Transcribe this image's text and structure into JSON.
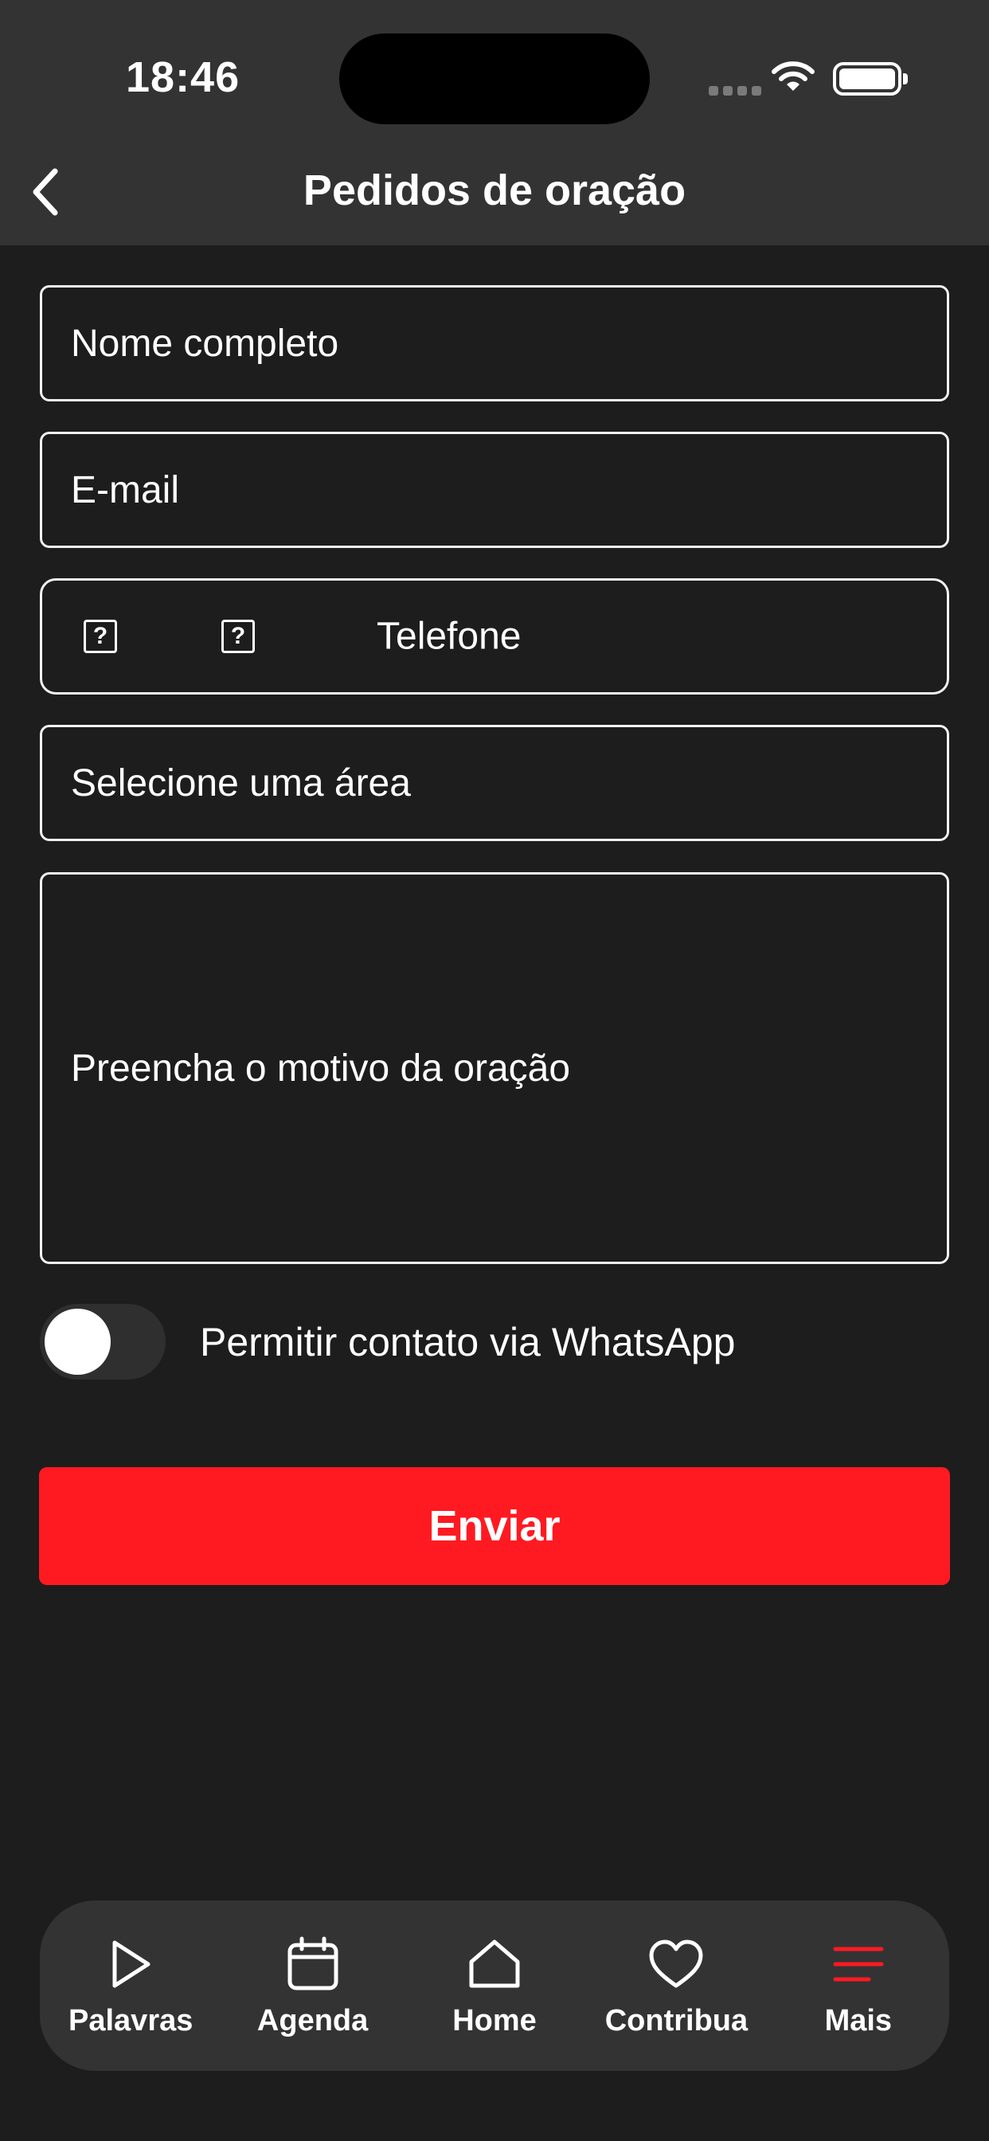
{
  "status": {
    "time": "18:46"
  },
  "header": {
    "title": "Pedidos de oração"
  },
  "form": {
    "name_placeholder": "Nome completo",
    "email_placeholder": "E-mail",
    "phone_placeholder": "Telefone",
    "phone_icon": "?",
    "area_placeholder": "Selecione uma área",
    "reason_placeholder": "Preencha o motivo da oração",
    "whatsapp_label": "Permitir contato via WhatsApp",
    "whatsapp_enabled": false,
    "submit_label": "Enviar"
  },
  "tabs": [
    {
      "label": "Palavras",
      "icon": "play-icon"
    },
    {
      "label": "Agenda",
      "icon": "calendar-icon"
    },
    {
      "label": "Home",
      "icon": "home-icon"
    },
    {
      "label": "Contribua",
      "icon": "heart-icon"
    },
    {
      "label": "Mais",
      "icon": "menu-icon",
      "active": true
    }
  ],
  "colors": {
    "accent": "#ff1a22",
    "background": "#1d1d1d",
    "header": "#333333"
  }
}
